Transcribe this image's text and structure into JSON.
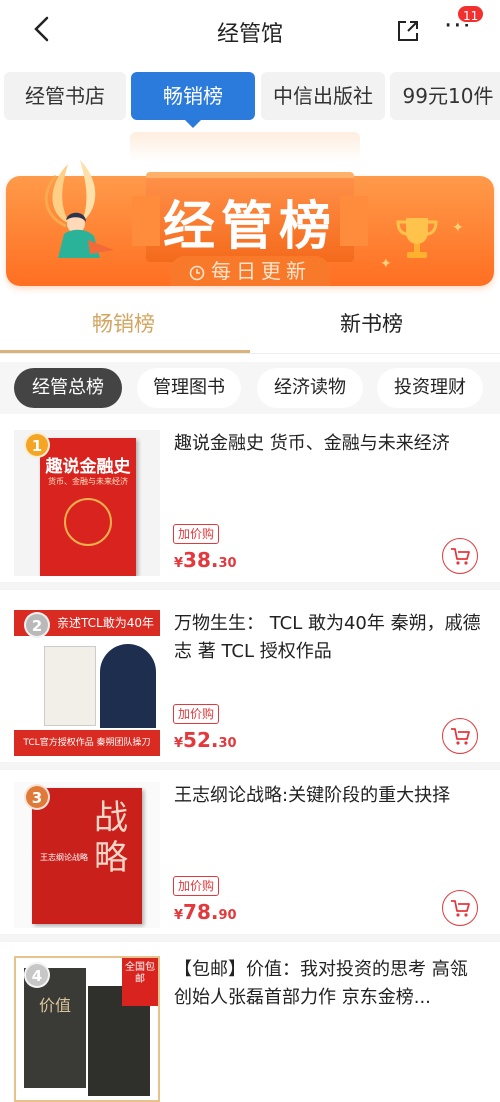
{
  "header": {
    "title": "经管馆",
    "badge_count": "11",
    "more_glyph": "···"
  },
  "tabs": [
    "经管书店",
    "畅销榜",
    "中信出版社",
    "99元10件"
  ],
  "banner": {
    "title": "经管榜",
    "subtitle": "每日更新"
  },
  "ranking_tabs": [
    "畅销榜",
    "新书榜"
  ],
  "chips": [
    "经管总榜",
    "管理图书",
    "经济读物",
    "投资理财"
  ],
  "books": [
    {
      "rank": "1",
      "title": "趣说金融史 货币、金融与未来经济",
      "tag": "加价购",
      "price_symbol": "¥",
      "price_int": "38.",
      "price_dec": "30",
      "cover_title": "趣说金融史",
      "cover_sub": "货币、金融与未来经济"
    },
    {
      "rank": "2",
      "title": "万物生生： TCL 敢为40年 秦朔，戚德志 著 TCL 授权作品",
      "tag": "加价购",
      "price_symbol": "¥",
      "price_int": "52.",
      "price_dec": "30",
      "cover_title": "亲述TCL敢为40年",
      "cover_sub": "TCL官方授权作品 秦朔团队操刀"
    },
    {
      "rank": "3",
      "title": "王志纲论战略:关键阶段的重大抉择",
      "tag": "加价购",
      "price_symbol": "¥",
      "price_int": "78.",
      "price_dec": "90",
      "cover_title": "战略",
      "cover_sub": "王志纲论战略"
    },
    {
      "rank": "4",
      "title": "【包邮】价值：我对投资的思考 高瓴创始人张磊首部力作 京东金榜...",
      "tag": "",
      "price_symbol": "",
      "price_int": "",
      "price_dec": "",
      "cover_title": "价值",
      "cover_sub": "全国包邮"
    }
  ],
  "colors": {
    "accent": "#e4393c",
    "tab_active": "#2a7bdc",
    "gold": "#d4a561",
    "banner": "#ff7a2e"
  }
}
